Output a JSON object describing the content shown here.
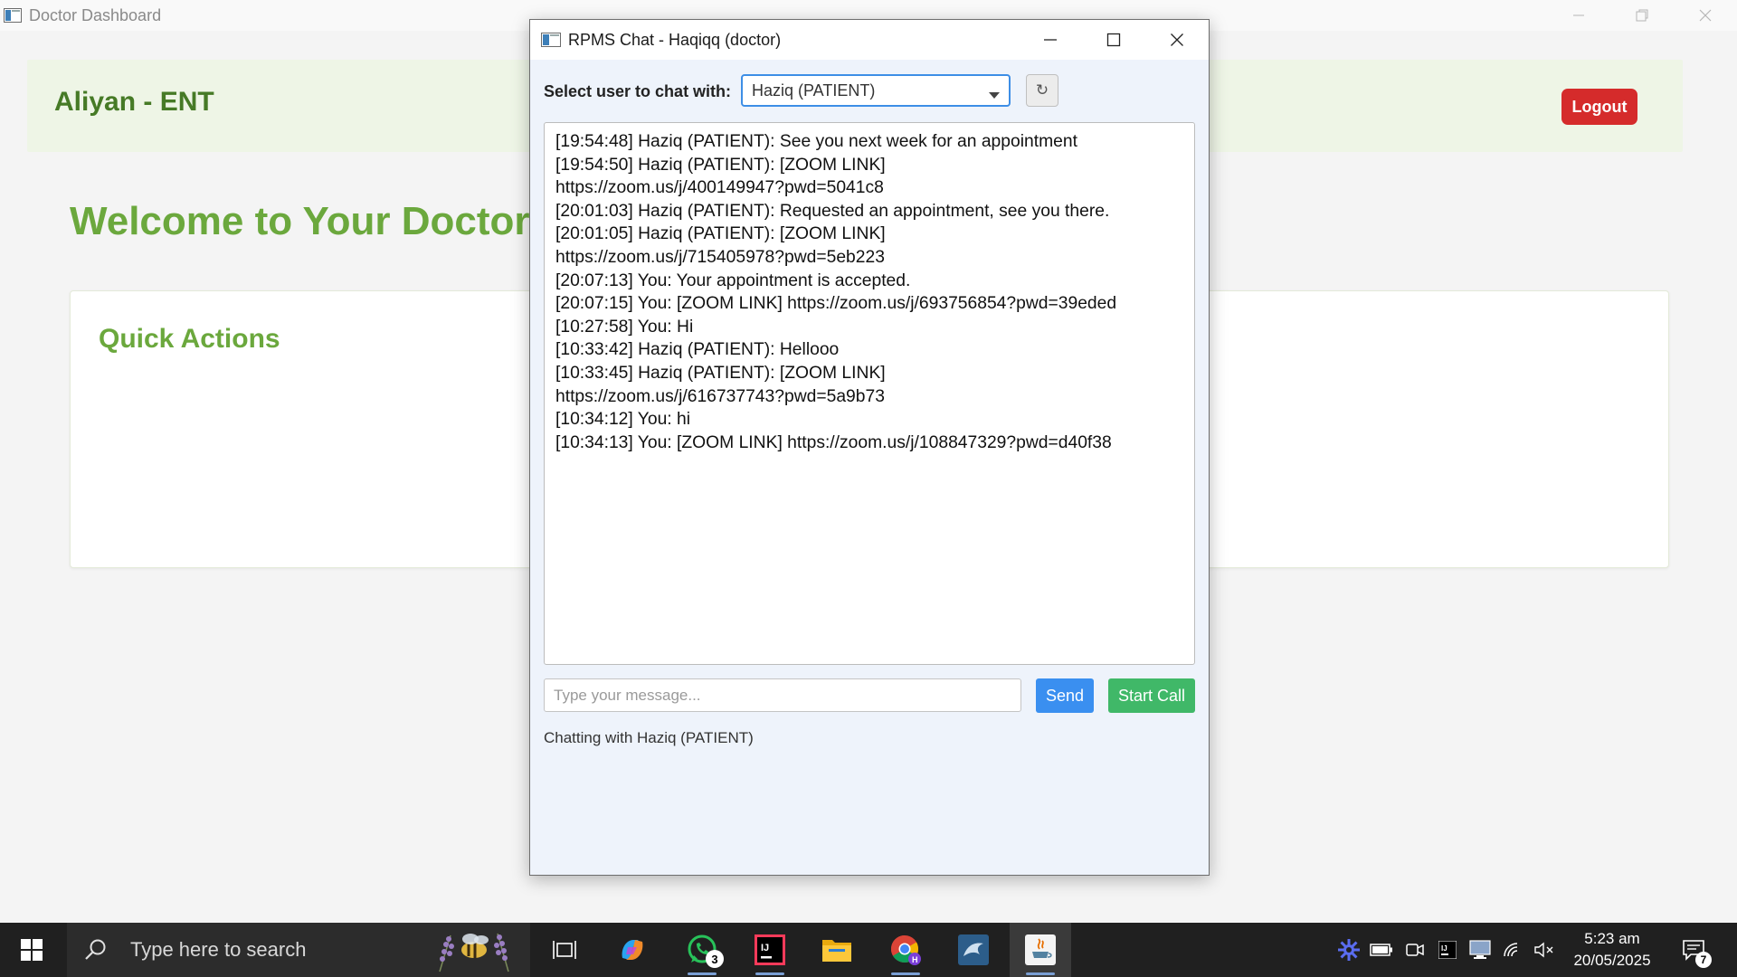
{
  "main_window": {
    "title": "Doctor Dashboard",
    "doctor_name": "Aliyan - ENT",
    "logout_label": "Logout",
    "welcome_text": "Welcome to Your Doctor Dashboard",
    "quick_actions_title": "Quick Actions"
  },
  "chat_window": {
    "title": "RPMS Chat - Haqiqq (doctor)",
    "select_label": "Select user to chat with:",
    "selected_user": "Haziq (PATIENT)",
    "refresh_glyph": "↻",
    "messages": [
      "[19:54:48] Haziq (PATIENT): See you next week for an appointment",
      "[19:54:50] Haziq (PATIENT): [ZOOM LINK]",
      "https://zoom.us/j/400149947?pwd=5041c8",
      "[20:01:03] Haziq (PATIENT): Requested an appointment, see you there.",
      "[20:01:05] Haziq (PATIENT): [ZOOM LINK]",
      "https://zoom.us/j/715405978?pwd=5eb223",
      "[20:07:13] You: Your appointment is accepted.",
      "[20:07:15] You: [ZOOM LINK] https://zoom.us/j/693756854?pwd=39eded",
      "[10:27:58] You: Hi",
      "[10:33:42] Haziq (PATIENT): Hellooo",
      "[10:33:45] Haziq (PATIENT): [ZOOM LINK]",
      "https://zoom.us/j/616737743?pwd=5a9b73",
      "[10:34:12] You: hi",
      "[10:34:13] You: [ZOOM LINK] https://zoom.us/j/108847329?pwd=d40f38"
    ],
    "message_input": {
      "value": "",
      "placeholder": "Type your message..."
    },
    "send_label": "Send",
    "start_call_label": "Start Call",
    "status_text": "Chatting with Haziq (PATIENT)"
  },
  "taskbar": {
    "search_placeholder": "Type here to search",
    "whatsapp_badge": "3",
    "clock_time": "5:23 am",
    "clock_date": "20/05/2025",
    "notification_count": "7"
  },
  "colors": {
    "header_bg": "#eef5e6",
    "doctor_name": "#467a26",
    "welcome_green": "#6ba83d",
    "logout_red": "#d52b2b",
    "send_blue": "#3a8ff0",
    "call_green": "#40b868",
    "select_border": "#3d8ee6"
  },
  "icons": [
    "window-app-icon",
    "minimize-icon",
    "maximize-icon",
    "restore-icon",
    "close-icon",
    "chevron-down-icon",
    "refresh-icon",
    "windows-start-icon",
    "search-icon",
    "task-view-icon",
    "copilot-icon",
    "whatsapp-icon",
    "intellij-icon",
    "file-explorer-icon",
    "chrome-icon",
    "mysql-workbench-icon",
    "java-icon",
    "settings-gear-icon",
    "battery-icon",
    "camera-icon",
    "intellij-tray-icon",
    "display-icon",
    "wifi-icon",
    "speaker-muted-icon",
    "notification-icon"
  ]
}
